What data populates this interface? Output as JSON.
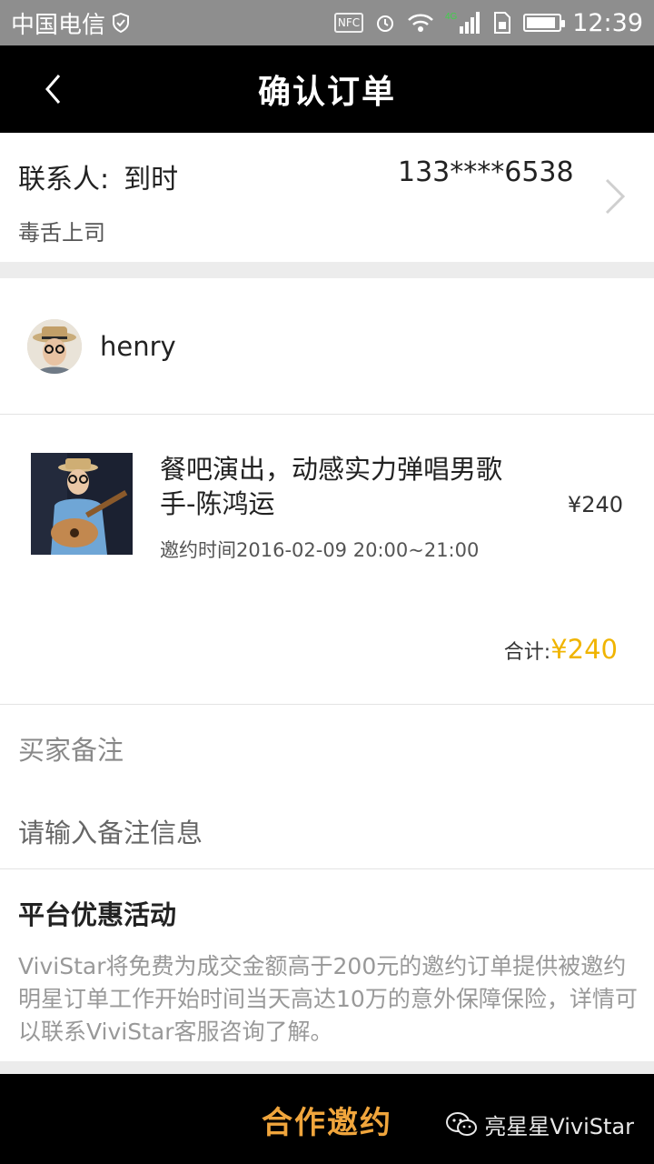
{
  "status_bar": {
    "carrier": "中国电信",
    "nfc": "NFC",
    "network": "4G",
    "time": "12:39",
    "battery_level": 0.9
  },
  "nav": {
    "title": "确认订单"
  },
  "contact": {
    "label": "联系人:",
    "name": "到时",
    "phone": "133****6538",
    "org": "毒舌上司"
  },
  "seller": {
    "name": "henry"
  },
  "item": {
    "title": "餐吧演出，动感实力弹唱男歌手-陈鸿运",
    "time": "邀约时间2016-02-09 20:00~21:00",
    "price": "¥240"
  },
  "total": {
    "label": "合计:",
    "amount": "¥240"
  },
  "remarks": {
    "label": "买家备注",
    "placeholder": "请输入备注信息"
  },
  "promo": {
    "title": "平台优惠活动",
    "description": "ViviStar将免费为成交金额高于200元的邀约订单提供被邀约明星订单工作开始时间当天高达10万的意外保障保险，详情可以联系ViviStar客服咨询了解。"
  },
  "bottom": {
    "cta_label": "合作邀约",
    "watermark": "亮星星ViviStar"
  },
  "colors": {
    "accent": "#f0b400",
    "cta": "#f0a53c",
    "nav_bg": "#000000",
    "status_bg": "#8e8e8e"
  }
}
